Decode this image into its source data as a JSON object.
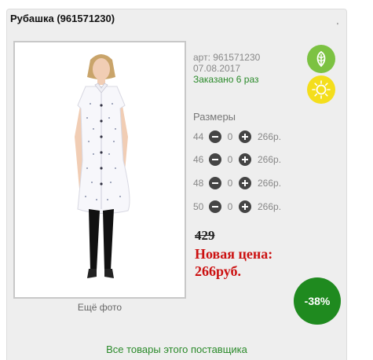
{
  "product": {
    "title": "Рубашка (961571230)",
    "corner_mark": "'",
    "art": "арт: 961571230",
    "date": "07.08.2017",
    "ordered": "Заказано 6 раз"
  },
  "photo": {
    "caption": "Ещё фото"
  },
  "badges": {
    "leaf_icon": "leaf-icon",
    "sun_icon": "sun-icon",
    "leaf_color": "#7cc242",
    "sun_color": "#f4de1c"
  },
  "sizes": {
    "title": "Размеры",
    "rows": [
      {
        "size": "44",
        "qty": "0",
        "price": "266р."
      },
      {
        "size": "46",
        "qty": "0",
        "price": "266р."
      },
      {
        "size": "48",
        "qty": "0",
        "price": "266р."
      },
      {
        "size": "50",
        "qty": "0",
        "price": "266р."
      }
    ]
  },
  "pricing": {
    "old_price": "429",
    "new_price_label": "Новая цена:",
    "new_price": "266руб.",
    "discount": "-38%",
    "accent_red": "#cc1111",
    "accent_green": "#1f8a1f"
  },
  "footer": {
    "all_goods": "Все товары этого поставщика"
  }
}
